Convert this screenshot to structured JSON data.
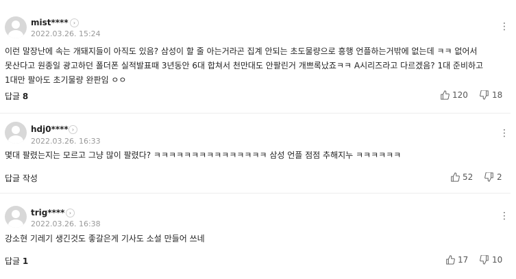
{
  "comments": [
    {
      "nickname": "mist****",
      "badge": "›",
      "date": "2022.03.26. 15:24",
      "text": "이런 말장난에 속는 개돼지들이 아직도 있음? 삼성이 할 줄 아는거라곤 집계 안되는 초도물량으로 흥행 언플하는거밖에 없는데 ㅋㅋ 없어서 못산다고 원종일 광고하던 폴더폰 실적발표때 3년동안 6대 합쳐서 천만대도 안팔린거 개쁘록났죠ㅋㅋ A시리즈라고 다르겠음? 1대 준비하고 1대만 팔아도 초기물량 완판임 ㅇㅇ",
      "reply_label": "답글",
      "reply_count": "8",
      "likes": "120",
      "dislikes": "18"
    },
    {
      "nickname": "hdj0****",
      "badge": "›",
      "date": "2022.03.26. 16:33",
      "text": "몇대 팔렸는지는 모르고 그냥 많이 팔렸다? ㅋㅋㅋㅋㅋㅋㅋㅋㅋㅋㅋㅋㅋㅋㅋ 삼성 언플 점점 추해지누 ㅋㅋㅋㅋㅋㅋ",
      "reply_label": "답글 작성",
      "reply_count": "",
      "likes": "52",
      "dislikes": "2"
    },
    {
      "nickname": "trig****",
      "badge": "›",
      "date": "2022.03.26. 16:38",
      "text": "강소현 기레기 생긴것도 좋갈은게 기사도 소설 만들어 쓰네",
      "reply_label": "답글",
      "reply_count": "1",
      "likes": "17",
      "dislikes": "10"
    }
  ],
  "icons": {
    "like": "thumbs-up-icon",
    "dislike": "thumbs-down-icon",
    "more": "more-vertical-icon"
  },
  "colors": {
    "divider": "#ececec",
    "meta": "#999999",
    "avatar": "#d8d8d8"
  }
}
